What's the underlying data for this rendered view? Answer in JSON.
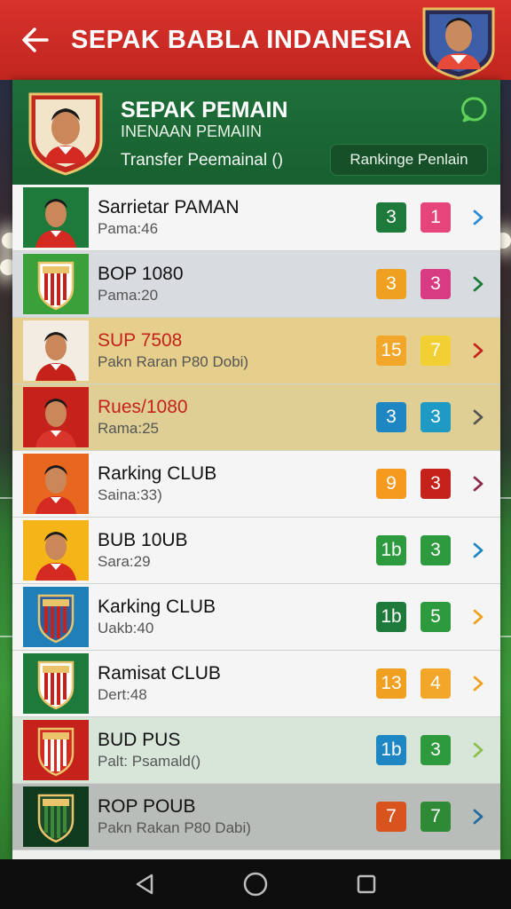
{
  "app": {
    "title": "SEPAK BABLA INDANESIA"
  },
  "header": {
    "title": "SEPAK PEMAIN",
    "subtitle": "INENAAN PEMAIIN",
    "transfer_label": "Transfer Peemainal ()",
    "ranking_button": "Rankinge Penlain"
  },
  "rows": [
    {
      "name": "Sarrietar PAMAN",
      "meta": "Pama:46",
      "badge1": "3",
      "badge2": "1",
      "c1": "#1e7a3a",
      "c2": "#e5457a",
      "bg": "#f4f5f4",
      "chev": "#2a8ad6",
      "logo": "player-green",
      "name_red": false
    },
    {
      "name": "BOP 1080",
      "meta": "Pama:20",
      "badge1": "3",
      "badge2": "3",
      "c1": "#f0a020",
      "c2": "#d93b82",
      "bg": "#d8dbe0",
      "chev": "#1e7a3a",
      "logo": "crest-green",
      "name_red": false
    },
    {
      "name": "SUP 7508",
      "meta": "Pakn Raran P80 Dobi)",
      "badge1": "15",
      "badge2": "7",
      "c1": "#f2a62a",
      "c2": "#f2d033",
      "bg": "#e6cf8c",
      "chev": "#c4221a",
      "logo": "player-red",
      "name_red": true
    },
    {
      "name": "Rues/1080",
      "meta": "Rama:25",
      "badge1": "3",
      "badge2": "3",
      "c1": "#1f86c4",
      "c2": "#1f9ac4",
      "bg": "#dfcf94",
      "chev": "#555555",
      "logo": "player-red2",
      "name_red": true
    },
    {
      "name": "Rarking CLUB",
      "meta": "Saina:33)",
      "badge1": "9",
      "badge2": "3",
      "c1": "#f59a1c",
      "c2": "#c4221a",
      "bg": "#f4f5f4",
      "chev": "#8a2a4a",
      "logo": "player-orange",
      "name_red": false
    },
    {
      "name": "BUB 10UB",
      "meta": "Sara:29",
      "badge1": "1b",
      "badge2": "3",
      "c1": "#2e9a3e",
      "c2": "#2e9a3e",
      "bg": "#f4f5f4",
      "chev": "#1f86c4",
      "logo": "player-yellow",
      "name_red": false
    },
    {
      "name": "Karking CLUB",
      "meta": "Uakb:40",
      "badge1": "1b",
      "badge2": "5",
      "c1": "#1e7a3a",
      "c2": "#2e9a3e",
      "bg": "#f4f5f4",
      "chev": "#f0a020",
      "logo": "crest-blue",
      "name_red": false
    },
    {
      "name": "Ramisat CLUB",
      "meta": "Dert:48",
      "badge1": "13",
      "badge2": "4",
      "c1": "#f0a020",
      "c2": "#f2a62a",
      "bg": "#f4f5f4",
      "chev": "#f0a020",
      "logo": "crest-green2",
      "name_red": false
    },
    {
      "name": "BUD PUS",
      "meta": "Palt: Psamald()",
      "badge1": "1b",
      "badge2": "3",
      "c1": "#1f86c4",
      "c2": "#2e9a3e",
      "bg": "#d8e6da",
      "chev": "#8cc04a",
      "logo": "crest-red",
      "name_red": false
    },
    {
      "name": "ROP POUB",
      "meta": "Pakn Rakan P80 Dabi)",
      "badge1": "7",
      "badge2": "7",
      "c1": "#d9531e",
      "c2": "#2e8a35",
      "bg": "#b9bdb9",
      "chev": "#1f6aa0",
      "logo": "crest-dark",
      "name_red": false
    }
  ]
}
